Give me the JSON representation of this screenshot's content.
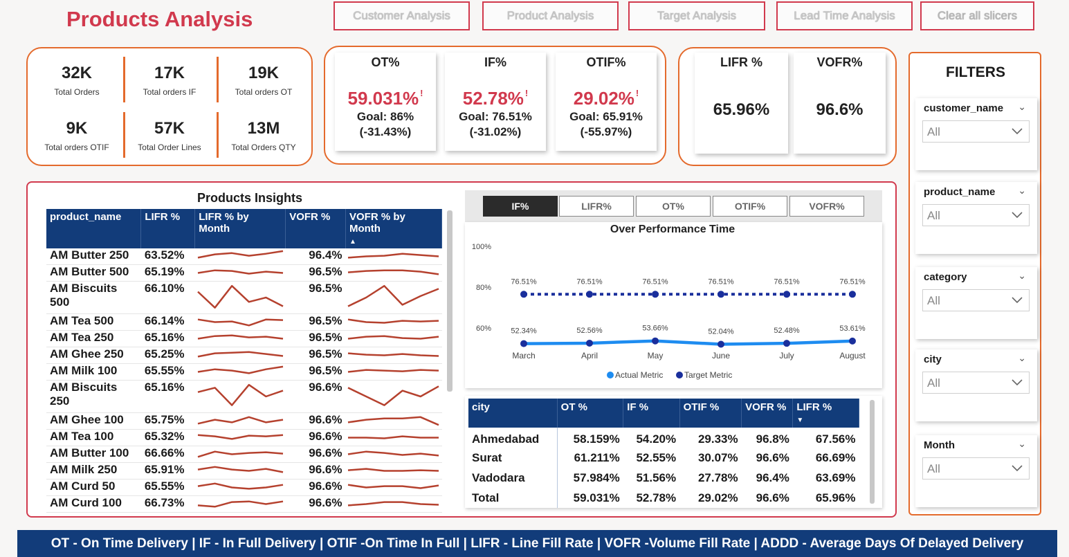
{
  "title": "Products Analysis",
  "nav": [
    "Customer Analysis",
    "Product Analysis",
    "Target Analysis",
    "Lead Time Analysis",
    "Clear all slicers"
  ],
  "kpis": [
    {
      "value": "32K",
      "label": "Total Orders"
    },
    {
      "value": "17K",
      "label": "Total orders IF"
    },
    {
      "value": "19K",
      "label": "Total orders OT"
    },
    {
      "value": "9K",
      "label": "Total orders OTIF"
    },
    {
      "value": "57K",
      "label": "Total Order Lines"
    },
    {
      "value": "13M",
      "label": "Total Orders QTY"
    }
  ],
  "metric_cards": [
    {
      "title": "OT%",
      "value": "59.031%",
      "goal": "Goal: 86%",
      "delta": "(-31.43%)",
      "alert": "!"
    },
    {
      "title": "IF%",
      "value": "52.78%",
      "goal": "Goal: 76.51%",
      "delta": "(-31.02%)",
      "alert": "!"
    },
    {
      "title": "OTIF%",
      "value": "29.02%",
      "goal": "Goal: 65.91%",
      "delta": "(-55.97%)",
      "alert": "!"
    }
  ],
  "rate_cards": [
    {
      "title": "LIFR %",
      "value": "65.96%"
    },
    {
      "title": "VOFR%",
      "value": "96.6%"
    }
  ],
  "insights": {
    "title": "Products Insights",
    "columns": [
      "product_name",
      "LIFR %",
      "LIFR % by Month",
      "VOFR %",
      "VOFR % by Month"
    ],
    "rows": [
      {
        "name": "AM Butter 250",
        "lifr": "63.52%",
        "vofr": "96.4%"
      },
      {
        "name": "AM Butter 500",
        "lifr": "65.19%",
        "vofr": "96.5%"
      },
      {
        "name": "AM Biscuits 500",
        "lifr": "66.10%",
        "vofr": "96.5%"
      },
      {
        "name": "AM Tea 500",
        "lifr": "66.14%",
        "vofr": "96.5%"
      },
      {
        "name": "AM Tea 250",
        "lifr": "65.16%",
        "vofr": "96.5%"
      },
      {
        "name": "AM Ghee 250",
        "lifr": "65.25%",
        "vofr": "96.5%"
      },
      {
        "name": "AM Milk 100",
        "lifr": "65.55%",
        "vofr": "96.5%"
      },
      {
        "name": "AM Biscuits 250",
        "lifr": "65.16%",
        "vofr": "96.6%"
      },
      {
        "name": "AM Ghee 100",
        "lifr": "65.75%",
        "vofr": "96.6%"
      },
      {
        "name": "AM Tea 100",
        "lifr": "65.32%",
        "vofr": "96.6%"
      },
      {
        "name": "AM Butter 100",
        "lifr": "66.66%",
        "vofr": "96.6%"
      },
      {
        "name": "AM Milk 250",
        "lifr": "65.91%",
        "vofr": "96.6%"
      },
      {
        "name": "AM Curd 50",
        "lifr": "65.55%",
        "vofr": "96.6%"
      },
      {
        "name": "AM Curd 100",
        "lifr": "66.73%",
        "vofr": "96.6%"
      }
    ]
  },
  "tabs": [
    "IF%",
    "LIFR%",
    "OT%",
    "OTIF%",
    "VOFR%"
  ],
  "active_tab": "IF%",
  "chart_data": {
    "type": "line",
    "title": "Over Performance Time",
    "categories": [
      "March",
      "April",
      "May",
      "June",
      "July",
      "August"
    ],
    "series": [
      {
        "name": "Actual Metric",
        "values": [
          52.34,
          52.56,
          53.66,
          52.04,
          52.48,
          53.61
        ],
        "labels": [
          "52.34%",
          "52.56%",
          "53.66%",
          "52.04%",
          "52.48%",
          "53.61%"
        ],
        "color": "#1e8cf0"
      },
      {
        "name": "Target  Metric",
        "values": [
          76.51,
          76.51,
          76.51,
          76.51,
          76.51,
          76.51
        ],
        "labels": [
          "76.51%",
          "76.51%",
          "76.51%",
          "76.51%",
          "76.51%",
          "76.51%"
        ],
        "color": "#1a2f9c"
      }
    ],
    "yticks": [
      "100%",
      "80%",
      "60%"
    ],
    "ylim": [
      50,
      100
    ],
    "legend": "bottom"
  },
  "city_table": {
    "columns": [
      "city",
      "OT %",
      "IF %",
      "OTIF %",
      "VOFR %",
      "LIFR %"
    ],
    "rows": [
      [
        "Ahmedabad",
        "58.159%",
        "54.20%",
        "29.33%",
        "96.8%",
        "67.56%"
      ],
      [
        "Surat",
        "61.211%",
        "52.55%",
        "30.07%",
        "96.6%",
        "66.69%"
      ],
      [
        "Vadodara",
        "57.984%",
        "51.56%",
        "27.78%",
        "96.4%",
        "63.69%"
      ],
      [
        "Total",
        "59.031%",
        "52.78%",
        "29.02%",
        "96.6%",
        "65.96%"
      ]
    ]
  },
  "filters": {
    "title": "FILTERS",
    "slicers": [
      {
        "label": "customer_name",
        "value": "All"
      },
      {
        "label": "product_name",
        "value": "All"
      },
      {
        "label": "category",
        "value": "All"
      },
      {
        "label": "city",
        "value": "All"
      },
      {
        "label": "Month",
        "value": "All"
      }
    ]
  },
  "footer": "OT - On Time Delivery | IF - In Full Delivery | OTIF -On Time In Full | LIFR - Line Fill Rate | VOFR -Volume Fill Rate | ADDD - Average Days Of Delayed Delivery",
  "colors": {
    "accent": "#d1394d",
    "border": "#e46a2c",
    "navy": "#123c7a",
    "spark": "#b5412e"
  }
}
